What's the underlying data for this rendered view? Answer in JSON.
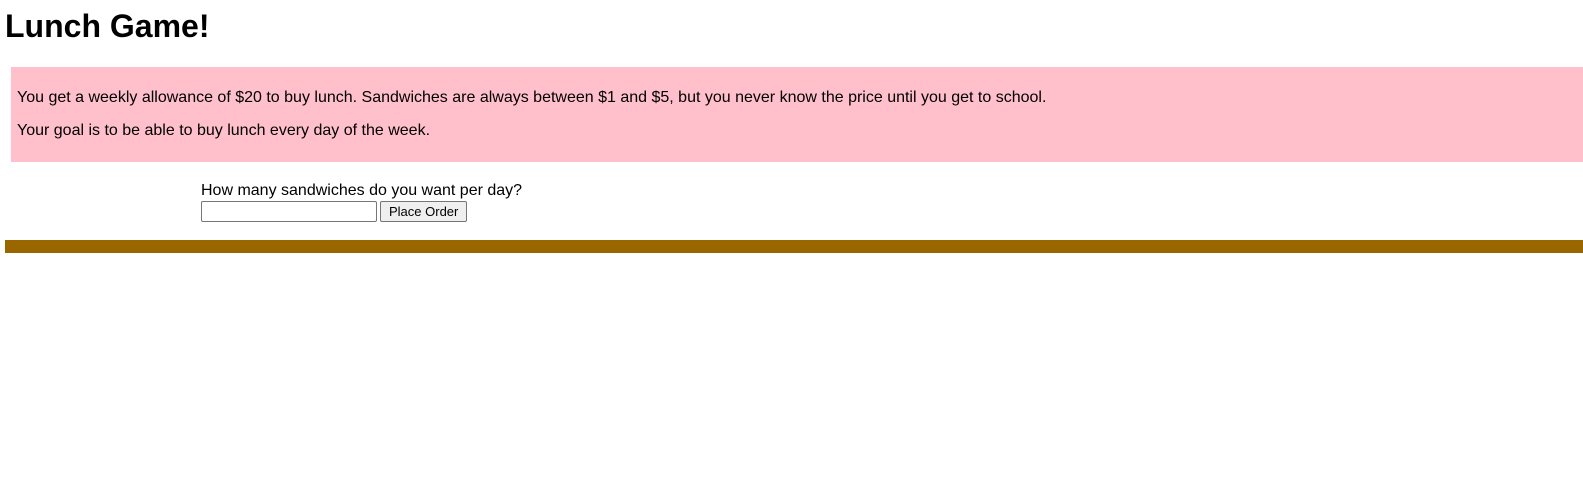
{
  "header": {
    "title": "Lunch Game!"
  },
  "instructions": {
    "line1": "You get a weekly allowance of $20 to buy lunch. Sandwiches are always between $1 and $5, but you never know the price until you get to school.",
    "line2": "Your goal is to be able to buy lunch every day of the week."
  },
  "order": {
    "question": "How many sandwiches do you want per day?",
    "input_value": "",
    "input_placeholder": "",
    "button_label": "Place Order"
  },
  "colors": {
    "info_background": "#ffc0cb",
    "divider": "#996600"
  }
}
